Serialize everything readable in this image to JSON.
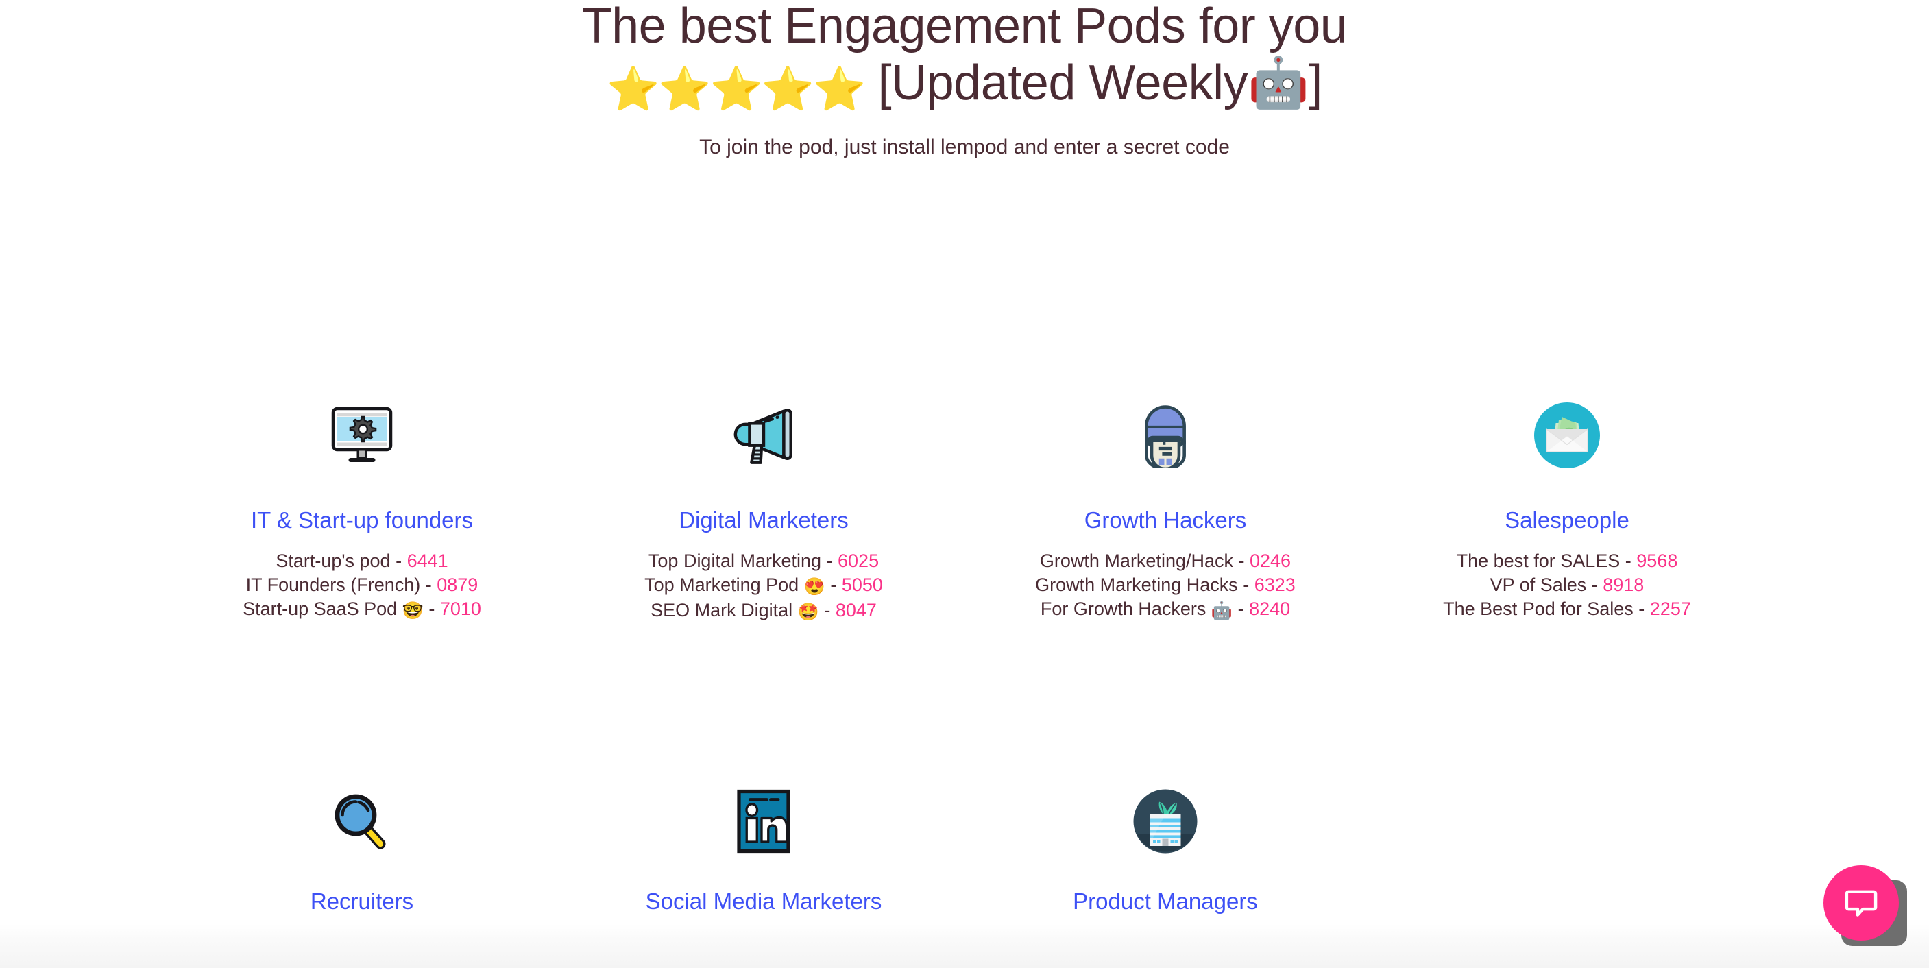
{
  "header": {
    "title_line_1": "The best Engagement Pods for you",
    "stars": "⭐⭐⭐⭐⭐",
    "title_line_2_prefix": " [Updated Weekly",
    "title_robot_emoji": "🤖",
    "title_line_2_suffix": "]",
    "subtitle": "To join the pod, just install lempod and enter a secret code"
  },
  "colors": {
    "heading": "#4a2b33",
    "category": "#3d50f5",
    "code": "#fa3288",
    "chat_accent": "#ff2d87",
    "background": "#ffffff"
  },
  "categories": [
    {
      "icon_name": "monitor-gear-icon",
      "name": "IT & Start-up founders",
      "pods": [
        {
          "label": "Start-up's pod - ",
          "emoji": "",
          "code": "6441"
        },
        {
          "label": "IT Founders (French) - ",
          "emoji": "",
          "code": "0879"
        },
        {
          "label": "Start-up SaaS Pod ",
          "emoji": "🤓",
          "sep": " - ",
          "code": "7010"
        }
      ]
    },
    {
      "icon_name": "megaphone-icon",
      "name": "Digital Marketers",
      "pods": [
        {
          "label": "Top Digital Marketing - ",
          "emoji": "",
          "code": "6025"
        },
        {
          "label": "Top Marketing Pod ",
          "emoji": "😍",
          "sep": " - ",
          "code": "5050"
        },
        {
          "label": "SEO Mark Digital ",
          "emoji": "🤩",
          "sep": "  - ",
          "code": "8047"
        }
      ]
    },
    {
      "icon_name": "hacker-visor-icon",
      "name": "Growth Hackers",
      "pods": [
        {
          "label": "Growth Marketing/Hack - ",
          "emoji": "",
          "code": "0246"
        },
        {
          "label": "Growth Marketing Hacks - ",
          "emoji": "",
          "code": "6323"
        },
        {
          "label": "For Growth Hackers ",
          "emoji": "🤖",
          "sep": "  - ",
          "code": "8240"
        }
      ]
    },
    {
      "icon_name": "money-envelope-icon",
      "name": "Salespeople",
      "pods": [
        {
          "label": "The best for SALES - ",
          "emoji": "",
          "code": "9568"
        },
        {
          "label": "VP of Sales - ",
          "emoji": "",
          "code": "8918"
        },
        {
          "label": "The Best Pod for Sales - ",
          "emoji": "",
          "code": "2257"
        }
      ]
    }
  ],
  "categories_row2": [
    {
      "icon_name": "magnifying-glass-icon",
      "name": "Recruiters"
    },
    {
      "icon_name": "linkedin-icon",
      "name": "Social Media Marketers"
    },
    {
      "icon_name": "office-building-plant-icon",
      "name": "Product Managers"
    }
  ],
  "chat": {
    "icon_name": "chat-bubble-icon",
    "aria_label": "Open chat"
  }
}
